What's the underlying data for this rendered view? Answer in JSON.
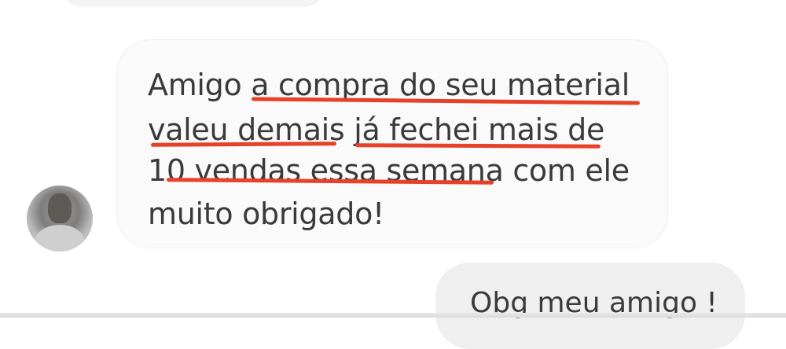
{
  "conversation": {
    "incoming_message": {
      "lines": [
        "Amigo a compra do seu material",
        "valeu demais já fechei mais de",
        "10 vendas essa semana com ele",
        "muito obrigado!"
      ],
      "highlight_color": "#e8412a"
    },
    "outgoing_message": {
      "text": "Obg meu amigo !"
    }
  },
  "colors": {
    "incoming_bubble": "#fafafa",
    "outgoing_bubble": "#efefef",
    "text": "#3a3a3a"
  }
}
